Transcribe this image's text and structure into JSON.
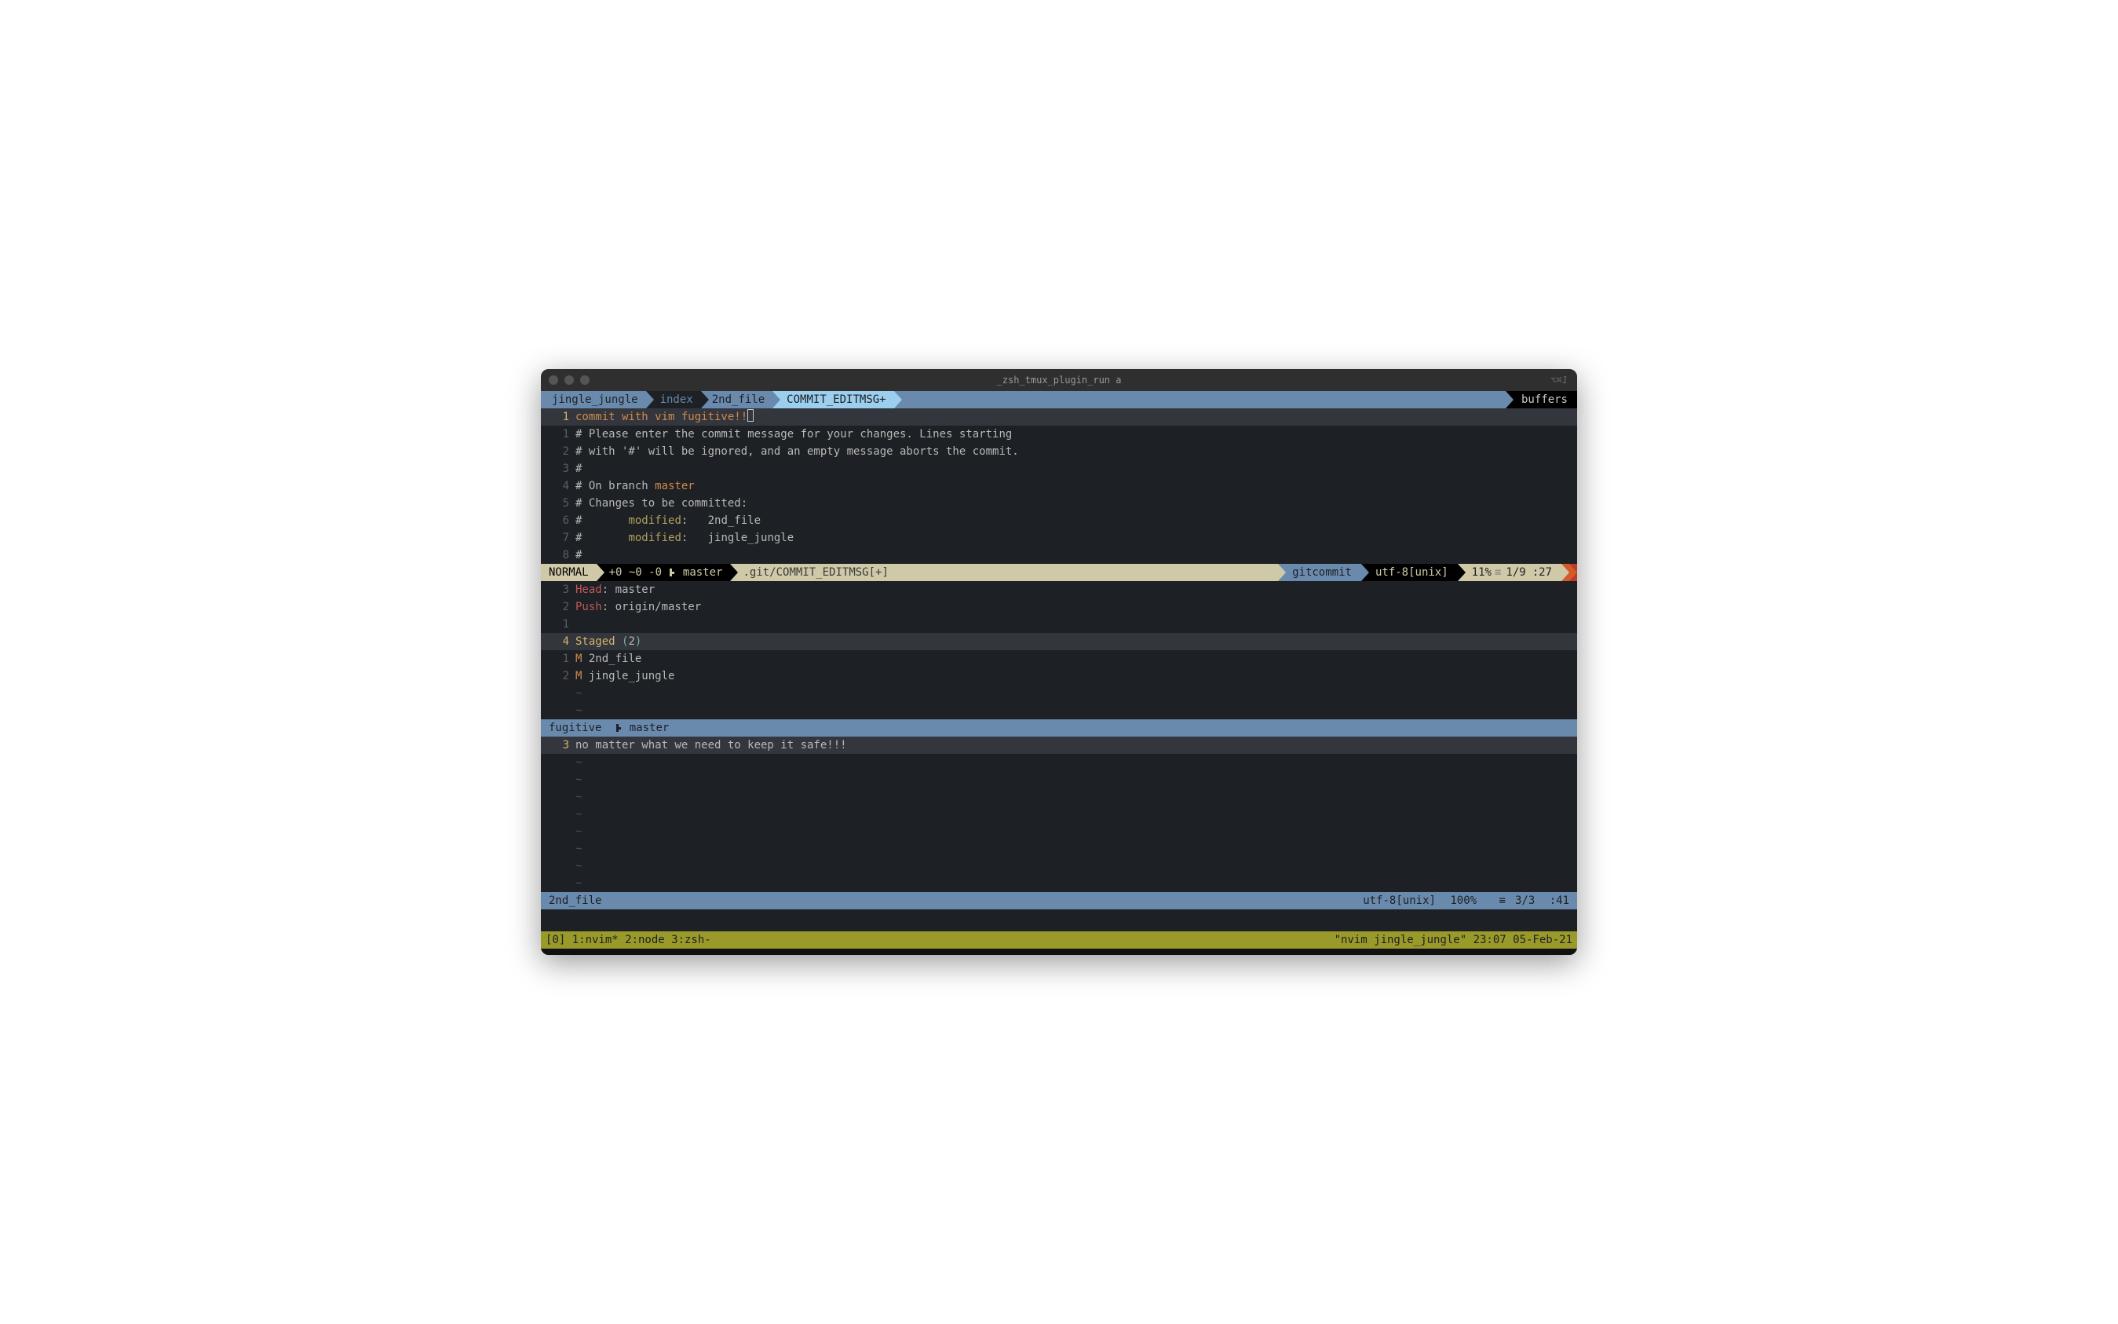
{
  "window": {
    "title": "_zsh_tmux_plugin_run a",
    "right_hint": "⌥⌘1"
  },
  "tabline": {
    "tabs": [
      "jingle_jungle",
      "index",
      "2nd_file",
      "COMMIT_EDITMSG+"
    ],
    "right": "buffers"
  },
  "pane1": {
    "rel_cursor": "1",
    "commit_msg": "commit with vim fugitive!!",
    "lines": [
      {
        "n": "1",
        "text": "# Please enter the commit message for your changes. Lines starting"
      },
      {
        "n": "2",
        "pre": "# with '#' will be ignored, and an empty message aborts the commit."
      },
      {
        "n": "3",
        "text": "#"
      },
      {
        "n": "4",
        "pre": "# On branch ",
        "branch": "master"
      },
      {
        "n": "5",
        "text": "# Changes to be committed:"
      },
      {
        "n": "6",
        "pre": "#       ",
        "kw": "modified",
        "post": ":   2nd_file"
      },
      {
        "n": "7",
        "pre": "#       ",
        "kw": "modified",
        "post": ":   jingle_jungle"
      },
      {
        "n": "8",
        "text": "#"
      }
    ]
  },
  "status1": {
    "mode": "NORMAL",
    "hunks": "+0 ~0 -0",
    "branch": "master",
    "file": ".git/COMMIT_EDITMSG[+]",
    "filetype": "gitcommit",
    "encoding": "utf-8[unix]",
    "percent": "11%",
    "line": "1/9",
    "col": ":27"
  },
  "pane2": {
    "rows": [
      {
        "n": "3",
        "label": "Head",
        "val": "master"
      },
      {
        "n": "2",
        "label": "Push",
        "val": "origin/master"
      },
      {
        "n": "1",
        "text": ""
      }
    ],
    "cur": {
      "n": "4",
      "label": "Staged",
      "count": "2"
    },
    "staged": [
      {
        "n": "1",
        "flag": "M",
        "file": "2nd_file"
      },
      {
        "n": "2",
        "flag": "M",
        "file": "jingle_jungle"
      }
    ]
  },
  "status2": {
    "left": "fugitive",
    "branch": "master"
  },
  "pane3": {
    "cur": {
      "n": "3",
      "text": "no matter what we need to keep it safe!!!"
    }
  },
  "status3": {
    "file": "2nd_file",
    "encoding": "utf-8[unix]",
    "percent": "100%",
    "line": "3/3",
    "col": ":41"
  },
  "tmux": {
    "left": "[0] 1:nvim* 2:node  3:zsh-",
    "right": "\"nvim jingle_jungle\" 23:07 05-Feb-21"
  }
}
